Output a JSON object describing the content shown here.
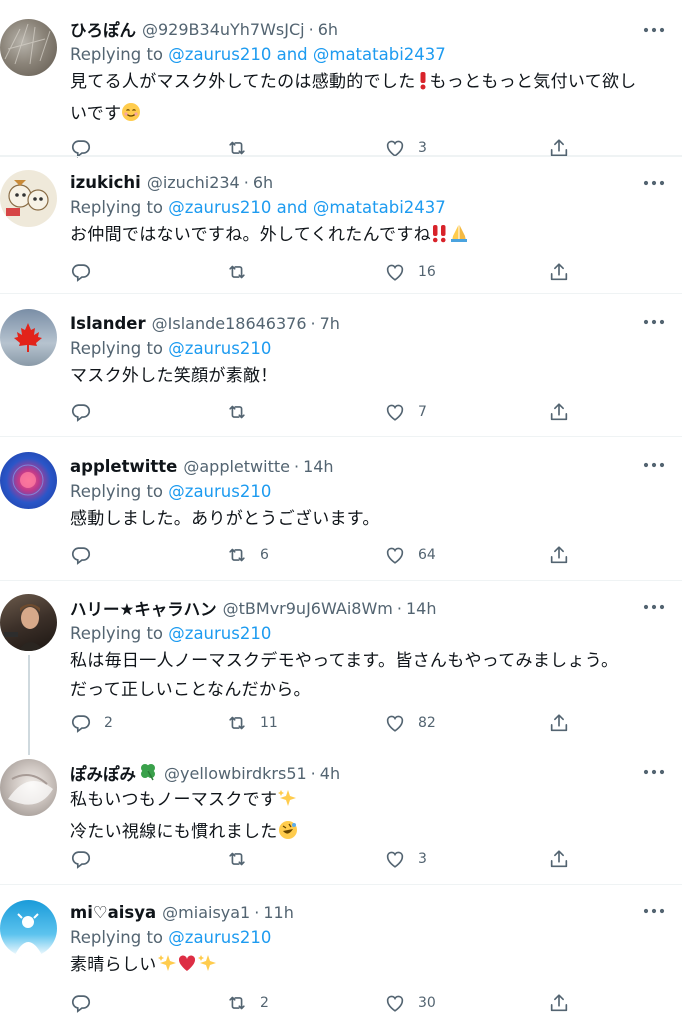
{
  "tweets": [
    {
      "name": "ひろぽん",
      "handle": "@929B34uYh7WsJCj",
      "time": "6h",
      "replying_prefix": "Replying to ",
      "replying_to": "@zaurus210 and @matatabi2437",
      "text1": "見てる人がマスク外してたのは感動的でした",
      "text2": "もっともっと気付いて欲し",
      "text3": "いです",
      "reply_count": "",
      "retweet_count": "",
      "like_count": "3"
    },
    {
      "name": "izukichi",
      "handle": "@izuchi234",
      "time": "6h",
      "replying_prefix": "Replying to ",
      "replying_to": "@zaurus210 and @matatabi2437",
      "text1": "お仲間ではないですね。外してくれたんですね",
      "reply_count": "",
      "retweet_count": "",
      "like_count": "16"
    },
    {
      "name": "Islander",
      "handle": "@Islande18646376",
      "time": "7h",
      "replying_prefix": "Replying to ",
      "replying_to": "@zaurus210",
      "text1": "マスク外した笑顔が素敵！",
      "reply_count": "",
      "retweet_count": "",
      "like_count": "7"
    },
    {
      "name": "appletwitte",
      "handle": "@appletwitte",
      "time": "14h",
      "replying_prefix": "Replying to ",
      "replying_to": "@zaurus210",
      "text1": "感動しました。ありがとうございます。",
      "reply_count": "",
      "retweet_count": "6",
      "like_count": "64"
    },
    {
      "name": "ハリー★キャラハン",
      "handle": "@tBMvr9uJ6WAi8Wm",
      "time": "14h",
      "replying_prefix": "Replying to ",
      "replying_to": "@zaurus210",
      "text1": "私は毎日一人ノーマスクデモやってます。皆さんもやってみましょう。",
      "text2": "だって正しいことなんだから。",
      "reply_count": "2",
      "retweet_count": "11",
      "like_count": "82"
    },
    {
      "name": "ぽみぽみ",
      "handle": "@yellowbirdkrs51",
      "time": "4h",
      "text1": "私もいつもノーマスクです",
      "text2": "冷たい視線にも慣れました",
      "reply_count": "",
      "retweet_count": "",
      "like_count": "3"
    },
    {
      "name": "mi♡aisya",
      "handle": "@miaisya1",
      "time": "11h",
      "replying_prefix": "Replying to ",
      "replying_to": "@zaurus210",
      "text1": "素晴らしい",
      "reply_count": "",
      "retweet_count": "2",
      "like_count": "30"
    }
  ],
  "separator": "·",
  "colors": {
    "accent": "#1d9bf0",
    "secondary_text": "#536471",
    "divider": "#eff3f4"
  }
}
